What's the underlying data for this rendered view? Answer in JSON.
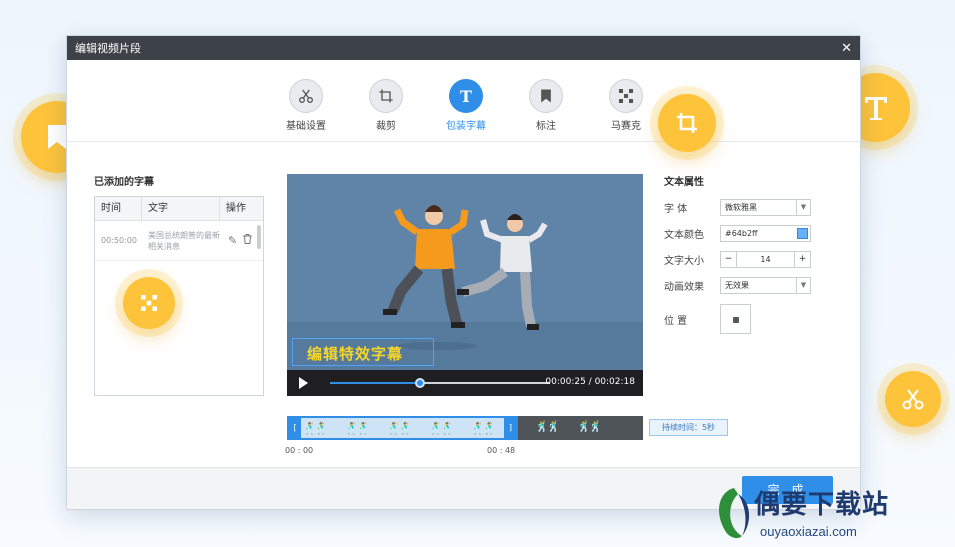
{
  "window": {
    "title": "编辑视频片段"
  },
  "toolbar": {
    "items": [
      {
        "label": "基础设置",
        "icon": "scissors-icon"
      },
      {
        "label": "裁剪",
        "icon": "crop-icon"
      },
      {
        "label": "包装字幕",
        "icon": "text-icon",
        "active": true
      },
      {
        "label": "标注",
        "icon": "bookmark-icon"
      },
      {
        "label": "马赛克",
        "icon": "mosaic-icon"
      }
    ]
  },
  "subtitles": {
    "heading": "已添加的字幕",
    "columns": [
      "时间",
      "文字",
      "操作"
    ],
    "rows": [
      {
        "time": "00:50:00",
        "text": "美国总统朗普的最新相关消息"
      }
    ]
  },
  "video": {
    "caption": "编辑特效字幕",
    "time": "00:00:25 / 00:02:18",
    "progress": 0.41
  },
  "timeline": {
    "start": "00 : 00",
    "end": "00 : 48",
    "duration": "持续时间：5秒",
    "selection": 0.65
  },
  "props": {
    "heading": "文本属性",
    "font_label": "字    体",
    "font_value": "微软雅黑",
    "color_label": "文本颜色",
    "color_value": "#64b2ff",
    "size_label": "文字大小",
    "size_value": "14",
    "anim_label": "动画效果",
    "anim_value": "无效果",
    "pos_label": "位    置"
  },
  "footer": {
    "done_label": "完 成"
  },
  "watermark": {
    "brand": "偶要下载站",
    "url": "ouyaoxiazai.com"
  },
  "colors": {
    "accent": "#2f8fe8",
    "bubble": "#fdc33a",
    "titlebar": "#3d4148"
  }
}
